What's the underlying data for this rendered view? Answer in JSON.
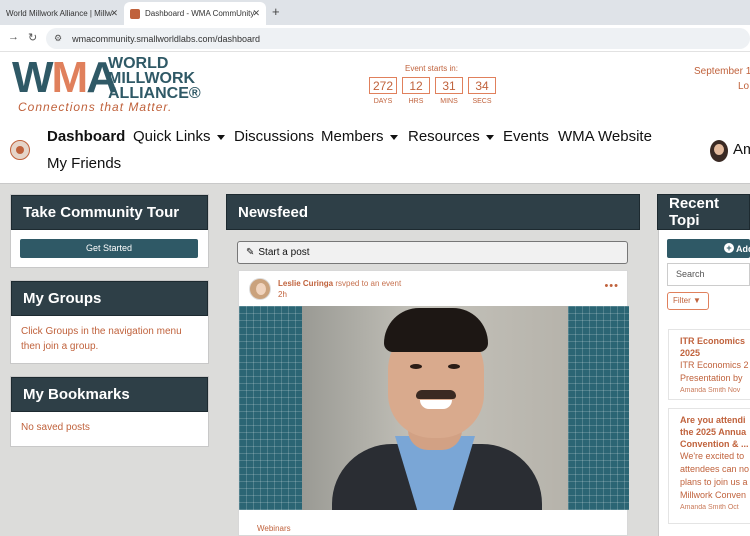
{
  "browser": {
    "tabs": [
      {
        "title": "World Millwork Alliance | Millw"
      },
      {
        "title": "Dashboard - WMA CommUnity"
      }
    ],
    "url": "wmacommunity.smallworldlabs.com/dashboard"
  },
  "logo": {
    "letters": [
      "W",
      "M",
      "A"
    ],
    "lines": [
      "WORLD",
      "MILLWORK",
      "ALLIANCE®"
    ],
    "tagline": "Connections that Matter."
  },
  "countdown": {
    "label": "Event starts in:",
    "units": [
      {
        "value": "272",
        "unit": "DAYS"
      },
      {
        "value": "12",
        "unit": "HRS"
      },
      {
        "value": "31",
        "unit": "MINS"
      },
      {
        "value": "34",
        "unit": "SECS"
      }
    ]
  },
  "header_right": {
    "date_line": "September 1",
    "second_line": "Lo"
  },
  "nav": {
    "items": [
      {
        "label": "Dashboard",
        "active": true,
        "dropdown": false
      },
      {
        "label": "Quick Links",
        "dropdown": true
      },
      {
        "label": "Discussions",
        "dropdown": false
      },
      {
        "label": "Members",
        "dropdown": true
      },
      {
        "label": "Resources",
        "dropdown": true
      },
      {
        "label": "Events",
        "dropdown": false
      },
      {
        "label": "WMA Website",
        "dropdown": false
      },
      {
        "label": "My Friends",
        "dropdown": false
      }
    ],
    "user_name": "Am"
  },
  "left_cards": {
    "tour": {
      "title": "Take Community Tour",
      "button": "Get Started"
    },
    "groups": {
      "title": "My Groups",
      "body": "Click Groups in the navigation menu then join a group."
    },
    "bookmarks": {
      "title": "My Bookmarks",
      "body": "No saved posts"
    }
  },
  "newsfeed": {
    "title": "Newsfeed",
    "start_post": "Start a post",
    "post": {
      "author": "Leslie Curinga",
      "action": "rsvped to an event",
      "time": "2h",
      "category": "Webinars"
    }
  },
  "recent_topics": {
    "title": "Recent Topi",
    "add_label": "Add",
    "search_placeholder": "Search",
    "filter_label": "Filter",
    "items": [
      {
        "title_lines": [
          "ITR Economics",
          "2025"
        ],
        "body_lines": [
          "ITR Economics 2",
          "Presentation by"
        ],
        "meta": "Amanda Smith Nov"
      },
      {
        "title_lines": [
          "Are you attendi",
          "the 2025 Annua",
          "Convention & ..."
        ],
        "body_lines": [
          "We're excited to",
          "attendees can no",
          "plans to join us a",
          "Millwork Conven"
        ],
        "meta": "Amanda Smith Oct"
      }
    ]
  },
  "colors": {
    "brand_teal": "#2f5966",
    "brand_orange": "#e0805c",
    "card_header": "#2e3f47",
    "page_bg": "#dcdcda"
  }
}
